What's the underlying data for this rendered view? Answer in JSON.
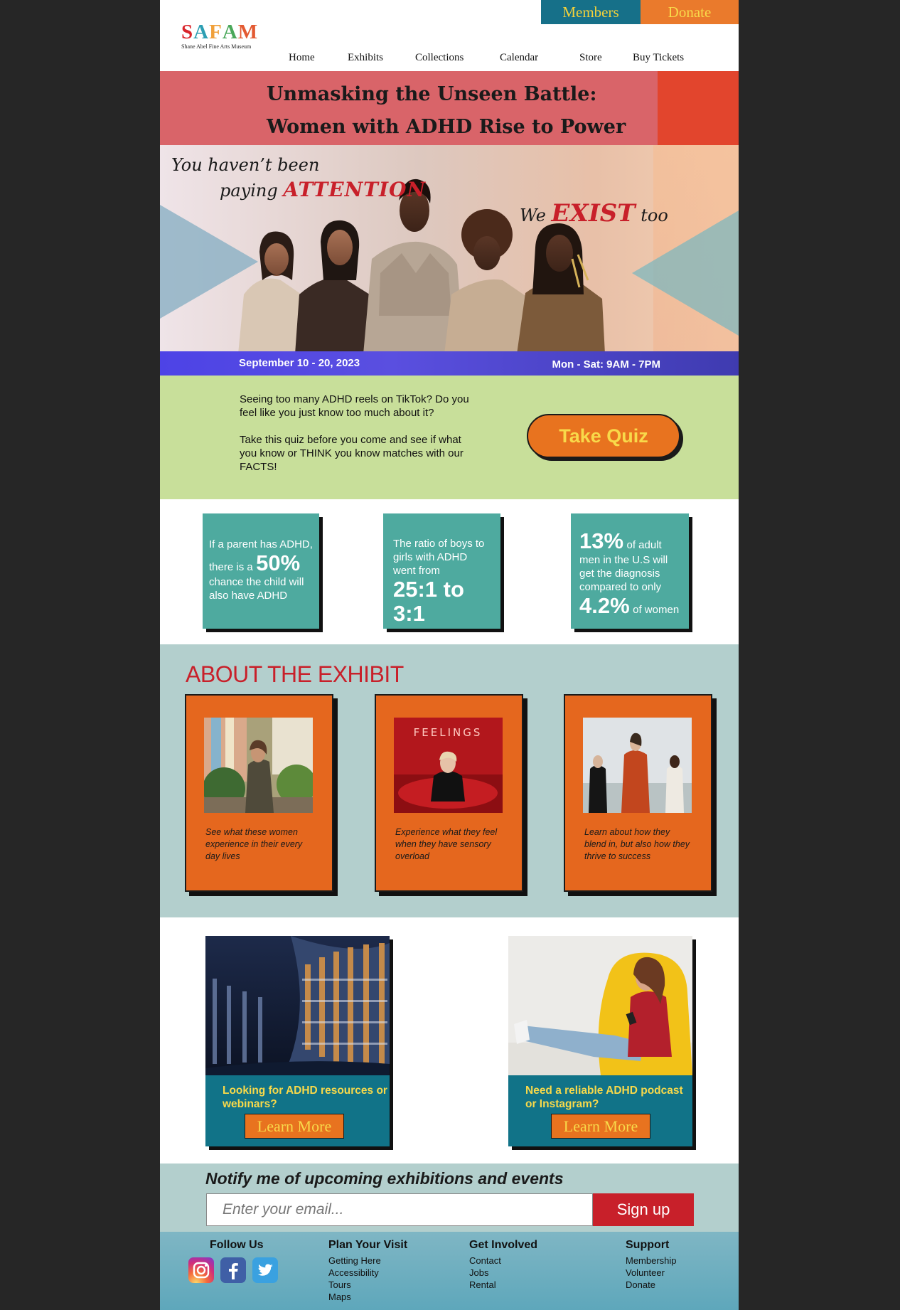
{
  "header": {
    "members_label": "Members",
    "donate_label": "Donate",
    "logo": {
      "letters": [
        "S",
        "A",
        "F",
        "A",
        "M"
      ],
      "letter_colors": [
        "#d9252b",
        "#2d9fb3",
        "#f0a03a",
        "#4aa85a",
        "#e35a32"
      ],
      "subtitle": "Shane Abel Fine Arts Museum"
    },
    "nav": [
      "Home",
      "Exhibits",
      "Collections",
      "Calendar",
      "Store",
      "Buy Tickets"
    ]
  },
  "title": {
    "line1": "Unmasking the Unseen Battle:",
    "line2": "Women with ADHD Rise to Power"
  },
  "hero": {
    "line1": "You haven’t been",
    "line2_pre": "paying ",
    "line2_em": "ATTENTION",
    "exist_pre": "We ",
    "exist_em": "EXIST",
    "exist_post": " too",
    "dates": "September 10 - 20, 2023",
    "hours": "Mon - Sat: 9AM - 7PM"
  },
  "quiz": {
    "text1": "Seeing too many ADHD reels on TikTok? Do you feel like you just know too much about it?",
    "text2": "Take this quiz before you come and see if what you know or THINK you know matches with our FACTS!",
    "button": "Take Quiz"
  },
  "stats": {
    "s1": {
      "a": "If a parent has ADHD,",
      "b": "there is a",
      "big": "50%",
      "c": "chance the child will also have ADHD"
    },
    "s2": {
      "a": "The ratio of boys to girls with ADHD went from",
      "big": "25:1 to 3:1"
    },
    "s3": {
      "big1": "13%",
      "a": "of adult",
      "b": "men in the U.S will get the diagnosis compared to only",
      "big2": "4.2%",
      "c": "of women"
    }
  },
  "about": {
    "heading": "ABOUT THE EXHIBIT",
    "cards": [
      {
        "caption": "See what these women experience in their every day lives"
      },
      {
        "caption": "Experience what they feel when they have sensory overload",
        "sign": "FEELINGS"
      },
      {
        "caption": "Learn about how they blend in, but also how they thrive to success"
      }
    ]
  },
  "resources": [
    {
      "text": "Looking for ADHD resources or webinars?",
      "button": "Learn More"
    },
    {
      "text": "Need a reliable ADHD podcast or Instagram?",
      "button": "Learn More"
    }
  ],
  "notify": {
    "heading": "Notify me of upcoming exhibitions and events",
    "placeholder": "Enter your email...",
    "button": "Sign up"
  },
  "footer": {
    "follow": "Follow Us",
    "social_icons": [
      "instagram-icon",
      "facebook-icon",
      "twitter-icon"
    ],
    "cols": [
      {
        "title": "Plan Your Visit",
        "links": [
          "Getting Here",
          "Accessibility",
          "Tours",
          "Maps"
        ]
      },
      {
        "title": "Get Involved",
        "links": [
          "Contact",
          "Jobs",
          "Rental"
        ]
      },
      {
        "title": "Support",
        "links": [
          "Membership",
          "Volunteer",
          "Donate"
        ]
      }
    ]
  },
  "colors": {
    "teal": "#167089",
    "orange": "#e8731f",
    "red": "#c8202a",
    "stat_teal": "#4eaa9f",
    "green": "#c8df9a",
    "sage": "#b3cfcd"
  }
}
